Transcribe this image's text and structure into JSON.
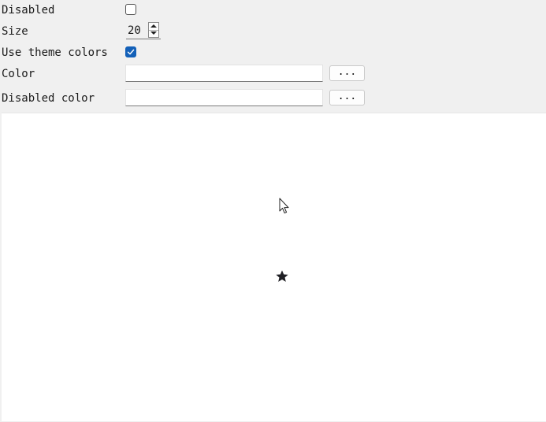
{
  "form": {
    "disabled": {
      "label": "Disabled",
      "checked": false
    },
    "size": {
      "label": "Size",
      "value": "20"
    },
    "use_theme_colors": {
      "label": "Use theme colors",
      "checked": true
    },
    "color": {
      "label": "Color",
      "value": "",
      "button_label": "..."
    },
    "disabled_color": {
      "label": "Disabled color",
      "value": "",
      "button_label": "..."
    }
  },
  "preview": {
    "icon": "star-icon",
    "cursor": "mouse-pointer-icon"
  },
  "colors": {
    "panel_bg": "#f0f0f0",
    "preview_bg": "#ffffff",
    "checkbox_checked": "#1360b8",
    "star": "#1f1f24"
  }
}
